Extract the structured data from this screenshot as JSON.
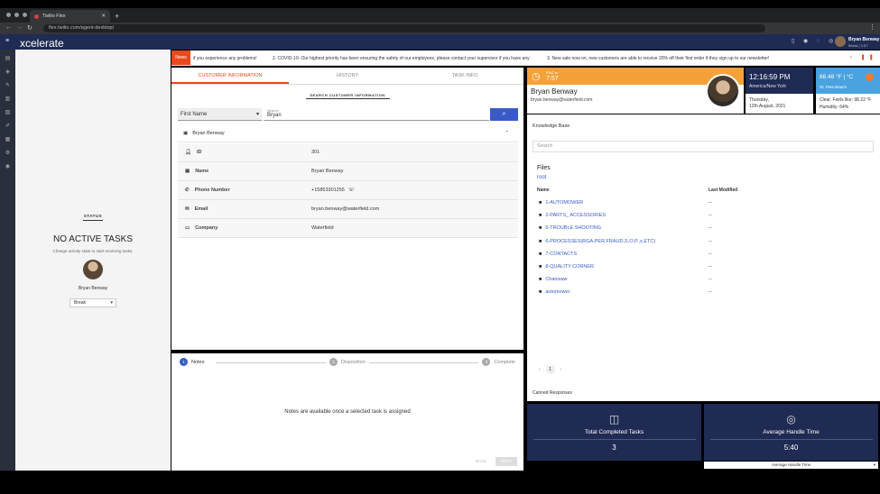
{
  "browser": {
    "tab_title": "Twilio Flex",
    "url": "flex.twilio.com/agent-desktop/"
  },
  "app": {
    "logo": "xcelerate",
    "user_name": "Bryan Benway",
    "user_status": "Break | 1:57"
  },
  "ticker": {
    "badge": "News",
    "items": [
      "if you experience any problems!",
      "2. COVID-19: Our highest priority has been ensuring the safety of our employees, please contact your supervisor if you have any",
      "3. New sale now on, new customers are able to receive 20% off their first order if they sign up to our newsletter!"
    ]
  },
  "status_panel": {
    "heading": "STATUS",
    "title": "NO ACTIVE TASKS",
    "subtitle": "Change activity state to start receiving tasks.",
    "agent_name": "Bryan Benway",
    "activity": "Break"
  },
  "center": {
    "tabs": [
      "CUSTOMER INFORMATION",
      "HISTORY",
      "TASK INFO"
    ],
    "search_title": "SEARCH CUSTOMER INFORMATION",
    "search_field": "First Name",
    "search_label": "Search",
    "search_value": "Bryan",
    "customer_name": "Bryan Benway",
    "fields": [
      {
        "label": "ID",
        "value": "301"
      },
      {
        "label": "Name",
        "value": "Bryan Benway"
      },
      {
        "label": "Phone Number",
        "value": "+15853301255"
      },
      {
        "label": "Email",
        "value": "bryan.benway@waterfield.com"
      },
      {
        "label": "Company",
        "value": "Waterfield"
      }
    ]
  },
  "notes": {
    "steps": [
      {
        "num": "1",
        "label": "Notes"
      },
      {
        "num": "2",
        "label": "Disposition"
      },
      {
        "num": "3",
        "label": "Complete"
      }
    ],
    "message": "Notes are available once a selected task is assigned",
    "back": "BACK",
    "next": "NEXT"
  },
  "profile": {
    "timer_small": "ENG.m",
    "timer": "7:57",
    "name": "Bryan Benway",
    "email": "bryan.benway@waterfield.com"
  },
  "clock": {
    "time": "12:16:59 PM",
    "zone": "America/New York",
    "day": "Thursday,",
    "date": "12th August, 2021"
  },
  "weather": {
    "temp": "88.48 °F | °C",
    "place": "St. Pete Beach",
    "cond": "Clear, Feels like: 98.22 °F",
    "humidity": "Humidity: 64%"
  },
  "kb": {
    "title": "Knowledge Base",
    "search_placeholder": "Search",
    "files_title": "Files",
    "root": "root",
    "col_name": "Name",
    "col_modified": "Last Modified",
    "files": [
      {
        "name": "1-AUTOMOWER",
        "modified": "--"
      },
      {
        "name": "2-PARTS_ ACCESSORIES",
        "modified": "--"
      },
      {
        "name": "5-TROUBLE SHOOTING",
        "modified": "--"
      },
      {
        "name": "6-PROCESSES(RGA,PER,FRAUD,S.O.P.,s,ETC)",
        "modified": "--"
      },
      {
        "name": "7-CONTACTS",
        "modified": "--"
      },
      {
        "name": "8-QUALITY CORNER",
        "modified": "--"
      },
      {
        "name": "Chainsaw",
        "modified": "--"
      },
      {
        "name": "automower",
        "modified": "--"
      }
    ],
    "page": "1",
    "canned": "Canned Responses"
  },
  "stats": [
    {
      "label": "Total Completed Tasks",
      "value": "3"
    },
    {
      "label": "Average Handle Time",
      "value": "5:40"
    }
  ],
  "stats_select": "Average Handle Time",
  "colors": {
    "navy": "#1f2b53",
    "orange": "#f5a13a",
    "blue": "#3a5bc7",
    "news": "#e8491d",
    "weather": "#4aa3e0"
  }
}
